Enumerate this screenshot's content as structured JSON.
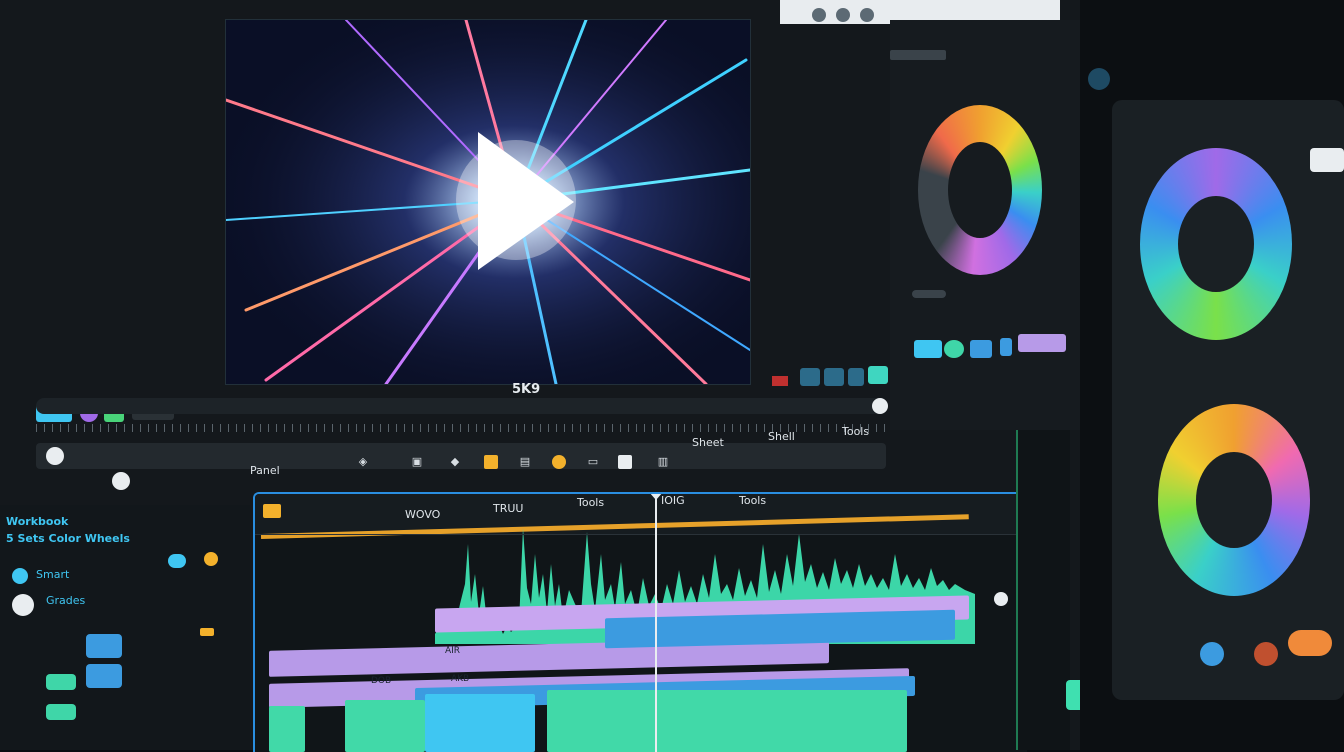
{
  "preview": {
    "clip_label": "5K9"
  },
  "toolbar": {
    "labels": [
      "Panel",
      "Sheet",
      "Shell",
      "Tools"
    ]
  },
  "left_panel": {
    "title": "Workbook",
    "subtitle": "5 Sets Color Wheels",
    "item_1": "Smart",
    "item_2": "Grades"
  },
  "timeline": {
    "ruler_labels": [
      "WOVO",
      "TRUU",
      "Tools",
      "IOIG",
      "Tools"
    ],
    "clip_labels": [
      "AIR",
      "DOB",
      "AKB"
    ]
  },
  "colors": {
    "accent_blue": "#2a8ee0",
    "track_purple": "#b79ae8",
    "track_blue": "#3c9be0",
    "track_green": "#41d9a8",
    "waveform": "#3fe0b0",
    "marker_orange": "#e6a12a"
  },
  "icons": [
    "play-icon",
    "shield-icon",
    "clip-icon",
    "marker-icon",
    "folder-icon",
    "file-icon",
    "palette-icon",
    "screen-icon",
    "document-icon",
    "monitor-icon"
  ]
}
